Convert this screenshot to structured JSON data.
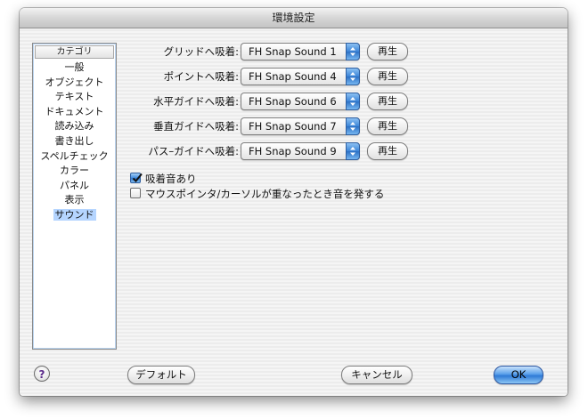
{
  "window": {
    "title": "環境設定"
  },
  "sidebar": {
    "header": "カテゴリ",
    "items": [
      {
        "label": "一般"
      },
      {
        "label": "オブジェクト"
      },
      {
        "label": "テキスト"
      },
      {
        "label": "ドキュメント"
      },
      {
        "label": "読み込み"
      },
      {
        "label": "書き出し"
      },
      {
        "label": "スペルチェック"
      },
      {
        "label": "カラー"
      },
      {
        "label": "パネル"
      },
      {
        "label": "表示"
      },
      {
        "label": "サウンド",
        "selected": true
      }
    ]
  },
  "sound_settings": [
    {
      "label": "グリッドへ吸着:",
      "value": "FH Snap Sound 1",
      "play": "再生"
    },
    {
      "label": "ポイントへ吸着:",
      "value": "FH Snap Sound 4",
      "play": "再生"
    },
    {
      "label": "水平ガイドへ吸着:",
      "value": "FH Snap Sound 6",
      "play": "再生"
    },
    {
      "label": "垂直ガイドへ吸着:",
      "value": "FH Snap Sound 7",
      "play": "再生"
    },
    {
      "label": "パス–ガイドへ吸着:",
      "value": "FH Snap Sound 9",
      "play": "再生"
    }
  ],
  "options": [
    {
      "label": "吸着音あり",
      "checked": true
    },
    {
      "label": "マウスポインタ/カーソルが重なったとき音を発する",
      "checked": false
    }
  ],
  "footer": {
    "help": "?",
    "defaults": "デフォルト",
    "cancel": "キャンセル",
    "ok": "OK"
  },
  "colors": {
    "accent": "#3b84d8",
    "selection": "#b5d5ff"
  }
}
